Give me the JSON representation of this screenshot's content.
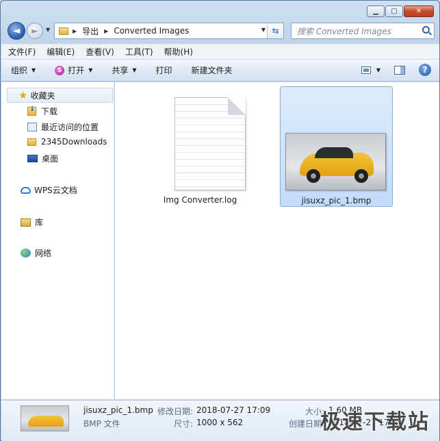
{
  "window": {
    "caption": {
      "minimize": "▁",
      "maximize": "▢",
      "close": "✕"
    }
  },
  "address": {
    "segments": [
      "导出",
      "Converted Images"
    ]
  },
  "search": {
    "placeholder": "搜索 Converted Images"
  },
  "menubar": {
    "items": [
      "文件(F)",
      "编辑(E)",
      "查看(V)",
      "工具(T)",
      "帮助(H)"
    ]
  },
  "toolbar": {
    "organize": "组织",
    "open": "打开",
    "share": "共享",
    "print": "打印",
    "new_folder": "新建文件夹",
    "help": "?"
  },
  "navpane": {
    "favorites": "收藏夹",
    "downloads": "下载",
    "recent": "最近访问的位置",
    "folder_2345": "2345Downloads",
    "desktop": "桌面",
    "wps": "WPS云文档",
    "libraries": "库",
    "network": "网络"
  },
  "files": [
    {
      "name": "Img Converter.log",
      "icon": "text-file-icon",
      "selected": false
    },
    {
      "name": "jisuxz_pic_1.bmp",
      "icon": "image-thumbnail",
      "selected": true
    }
  ],
  "details": {
    "filename": "jisuxz_pic_1.bmp",
    "type": "BMP 文件",
    "modified_label": "修改日期:",
    "modified_value": "2018-07-27 17:09",
    "dimensions_label": "尺寸:",
    "dimensions_value": "1000 x 562",
    "size_label": "大小:",
    "size_value": "1.60 MB",
    "created_label": "创建日期:",
    "created_value": "2018-07-27 17:09"
  },
  "watermark": "极速下载站",
  "colors": {
    "selection": "#c2dcfd",
    "accent": "#2f66b6"
  }
}
